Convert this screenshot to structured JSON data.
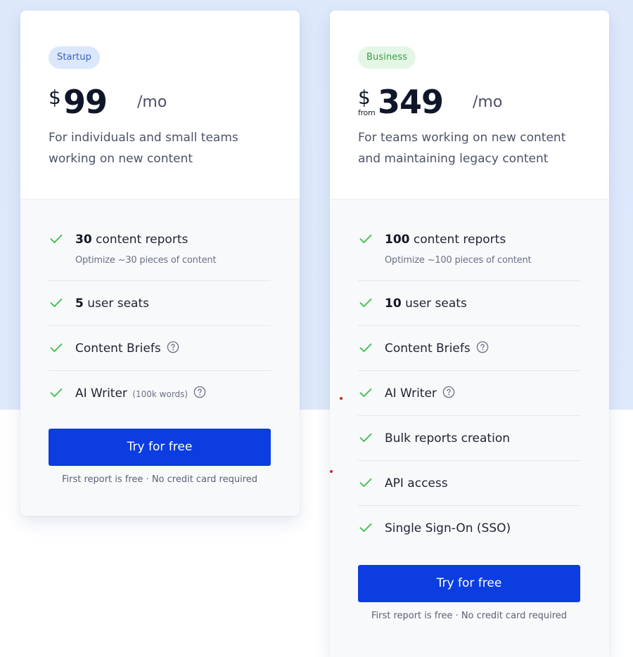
{
  "colors": {
    "accent": "#0b3de0",
    "check": "#4ec25a",
    "background_band": "#dde8fb",
    "startup_badge_bg": "#dbe7fb",
    "business_badge_bg": "#e4f6e6"
  },
  "icons": {
    "check": "check-icon",
    "help": "question-circle-icon"
  },
  "startup": {
    "badge": "Startup",
    "currency": "$",
    "amount": "99",
    "per": "/mo",
    "description": "For individuals and small teams working on new content",
    "features": [
      {
        "strong": "30",
        "text": " content reports",
        "sub": "Optimize ~30 pieces of content"
      },
      {
        "strong": "5",
        "text": " user seats"
      },
      {
        "text": "Content Briefs"
      },
      {
        "text": "AI Writer",
        "note": "(100k words)"
      }
    ],
    "cta": "Try for free",
    "cta_note": "First report is free · No credit card required"
  },
  "business": {
    "badge": "Business",
    "currency": "$",
    "from": "from",
    "amount": "349",
    "per": "/mo",
    "description": "For teams working on new content and maintaining legacy content",
    "features": [
      {
        "strong": "100",
        "text": " content reports",
        "sub": "Optimize ~100 pieces of content"
      },
      {
        "strong": "10",
        "text": " user seats"
      },
      {
        "text": "Content Briefs"
      },
      {
        "text": "AI Writer"
      },
      {
        "text": "Bulk reports creation"
      },
      {
        "text": "API access"
      },
      {
        "text": "Single Sign-On (SSO)"
      }
    ],
    "cta": "Try for free",
    "cta_note": "First report is free · No credit card required"
  }
}
